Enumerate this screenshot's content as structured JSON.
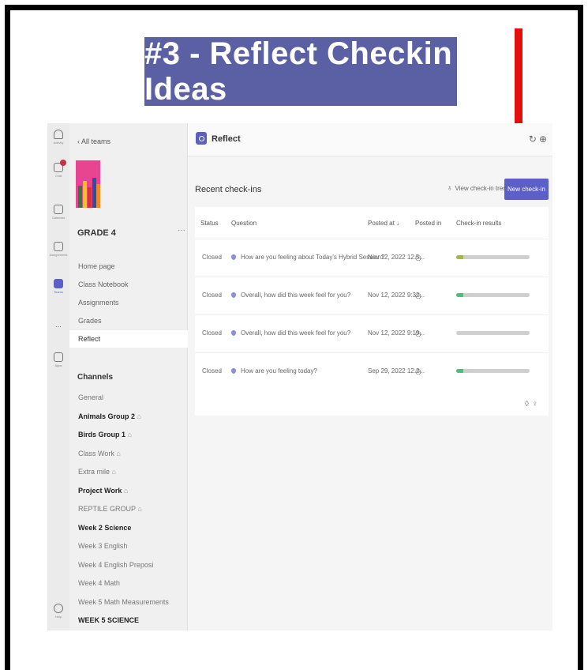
{
  "banner": {
    "title": "#3 - Reflect Checkin Ideas"
  },
  "rail": {
    "items": [
      {
        "label": "Activity",
        "icon": "bell-icon"
      },
      {
        "label": "Chat",
        "icon": "chat-icon"
      },
      {
        "label": "Calendar",
        "icon": "calendar-icon"
      },
      {
        "label": "Assignments",
        "icon": "assignments-icon"
      },
      {
        "label": "Teams",
        "icon": "teams-icon"
      },
      {
        "label": "...",
        "icon": "more-icon"
      },
      {
        "label": "Apps",
        "icon": "apps-icon"
      },
      {
        "label": "Help",
        "icon": "help-icon"
      }
    ]
  },
  "sidebar": {
    "back_label": "All teams",
    "team_name": "GRADE 4",
    "more": "···",
    "nav": [
      "Home page",
      "Class Notebook",
      "Assignments",
      "Grades",
      "Reflect"
    ],
    "channels_heading": "Channels",
    "channels": [
      {
        "name": "General",
        "bold": false,
        "private": false
      },
      {
        "name": "Animals Group 2",
        "bold": true,
        "private": true
      },
      {
        "name": "Birds Group 1",
        "bold": true,
        "private": true
      },
      {
        "name": "Class Work",
        "bold": false,
        "private": true
      },
      {
        "name": "Extra mile",
        "bold": false,
        "private": true
      },
      {
        "name": "Project Work",
        "bold": true,
        "private": true
      },
      {
        "name": "REPTILE GROUP",
        "bold": false,
        "private": true
      },
      {
        "name": "Week 2 Science",
        "bold": true,
        "private": false
      },
      {
        "name": "Week 3 English",
        "bold": false,
        "private": false
      },
      {
        "name": "Week 4 English Preposi",
        "bold": false,
        "private": false
      },
      {
        "name": "Week 4 Math",
        "bold": false,
        "private": false
      },
      {
        "name": "Week 5 Math Measurements",
        "bold": false,
        "private": false
      },
      {
        "name": "WEEK 5 SCIENCE",
        "bold": true,
        "private": false
      }
    ]
  },
  "main": {
    "app_title": "Reflect",
    "recent_label": "Recent check-ins",
    "trends_label": "View check-in trends",
    "new_button": "New check-in",
    "columns": [
      "Status",
      "Question",
      "Posted at ↓",
      "Posted in",
      "Check-in results"
    ],
    "rows": [
      {
        "status": "Closed",
        "question": "How are you feeling about Today's Hybrid Session?",
        "posted_at": "Nov 12, 2022 12:5...",
        "fill": 0.1,
        "color": "#a4b84a"
      },
      {
        "status": "Closed",
        "question": "Overall, how did this week feel for you?",
        "posted_at": "Nov 12, 2022 9:32...",
        "fill": 0.1,
        "color": "#4bbf83"
      },
      {
        "status": "Closed",
        "question": "Overall, how did this week feel for you?",
        "posted_at": "Nov 12, 2022 9:19...",
        "fill": 0.0,
        "color": "#4bbf83"
      },
      {
        "status": "Closed",
        "question": "How are you feeling today?",
        "posted_at": "Sep 29, 2022 12:2...",
        "fill": 0.1,
        "color": "#4bbf83"
      }
    ]
  },
  "colors": {
    "accent": "#5b5fc7",
    "banner": "#5b5fa3",
    "arrow": "#e30f0f"
  }
}
